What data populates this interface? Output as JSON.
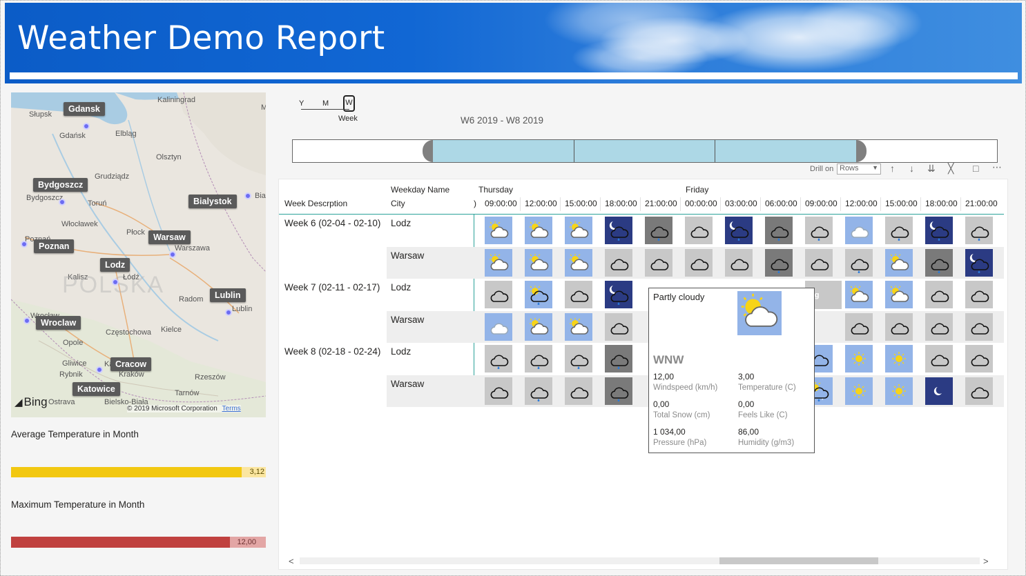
{
  "report": {
    "title": "Weather Demo Report"
  },
  "map": {
    "cities": [
      "Gdansk",
      "Bydgoszcz",
      "Bialystok",
      "Warsaw",
      "Poznan",
      "Lodz",
      "Lublin",
      "Wroclaw",
      "Cracow",
      "Katowice"
    ],
    "places": [
      "Kaliningrad",
      "Słupsk",
      "Gdańsk",
      "Elbląg",
      "Olsztyn",
      "Grudziądz",
      "Bydgoszcz",
      "Toruń",
      "Bia",
      "Włocławek",
      "Płock",
      "Warszawa",
      "Poznań",
      "Kalisz",
      "POLSKA",
      "Łódź",
      "Radom",
      "Lublin",
      "Wrocław",
      "Kielce",
      "Częstochowa",
      "Opole",
      "Gliwice",
      "Katowice",
      "Kraków",
      "Rybnik",
      "Rzeszów",
      "Tarnów",
      "Ostrava",
      "Bielsko-Biała",
      "M"
    ],
    "brand": "Bing",
    "copyright": "© 2019 Microsoft Corporation",
    "terms": "Terms"
  },
  "kpis": [
    {
      "title": "Average Temperature in Month",
      "value": "3,12",
      "fill": 0.905,
      "color": "#f2c811"
    },
    {
      "title": "Maximum Temperature in Month",
      "value": "12,00",
      "fill": 0.86,
      "color": "#c0413f"
    }
  ],
  "slicer": {
    "levels": [
      "Y",
      "M",
      "W"
    ],
    "level_caption": "Week",
    "range": "W6 2019 - W8 2019"
  },
  "toolbar": {
    "drill_label": "Drill on",
    "drill_value": "Rows"
  },
  "matrix": {
    "col_header_1": "Week Descrption",
    "row_header_1": "Weekday Name",
    "row_header_2": "City",
    "days": [
      "Thursday",
      "Friday"
    ],
    "partial_col": ")",
    "times": [
      "09:00:00",
      "12:00:00",
      "15:00:00",
      "18:00:00",
      "21:00:00",
      "00:00:00",
      "03:00:00",
      "06:00:00",
      "09:00:00",
      "12:00:00",
      "15:00:00",
      "18:00:00",
      "21:00:00"
    ],
    "rows": [
      {
        "week": "Week 6 (02-04 - 02-10)",
        "city": "Lodz"
      },
      {
        "week": "",
        "city": "Warsaw"
      },
      {
        "week": "Week 7 (02-11 - 02-17)",
        "city": "Lodz"
      },
      {
        "week": "",
        "city": "Warsaw"
      },
      {
        "week": "Week 8 (02-18 - 02-24)",
        "city": "Lodz"
      },
      {
        "week": "",
        "city": "Warsaw"
      }
    ],
    "partial_label": "og",
    "icons": [
      [
        "pcloudy",
        "pcloudy",
        "pcloudy",
        "night-rain",
        "cloud-rain-dark",
        "cloud",
        "night-rain",
        "cloud-rain-dark",
        "cloud-rain",
        "pcloud-light",
        "cloud-rain",
        "night-rain",
        "cloud-rain"
      ],
      [
        "pcloudy",
        "pcloudy",
        "pcloudy",
        "cloud",
        "cloud",
        "cloud",
        "cloud",
        "cloud-rain-dark",
        "cloud",
        "cloud-rain",
        "pcloudy",
        "cloud-rain-dark",
        "night-rain"
      ],
      [
        "cloud",
        "pcloudy-rain",
        "cloud",
        "night-rain",
        "",
        "",
        "",
        "",
        "pcloudy-gray",
        "pcloudy",
        "pcloudy",
        "cloud",
        "cloud"
      ],
      [
        "pcloud-light",
        "pcloudy",
        "pcloudy",
        "cloud",
        "",
        "",
        "",
        "",
        "fog",
        "cloud",
        "cloud",
        "cloud",
        "cloud"
      ],
      [
        "cloud-rain",
        "cloud-rain",
        "cloud-rain",
        "cloud-rain-dark",
        "",
        "",
        "",
        "",
        "cloud-blue",
        "sunny",
        "sunny",
        "cloud",
        "cloud"
      ],
      [
        "cloud",
        "cloud-rain",
        "cloud",
        "cloud-rain-dark",
        "",
        "",
        "",
        "",
        "pcloudy-snow",
        "sunny",
        "sunny",
        "night-clear",
        "cloud"
      ]
    ]
  },
  "tooltip": {
    "condition": "Partly cloudy",
    "wind_dir": "WNW",
    "items": [
      {
        "value": "12,00",
        "label": "Windspeed (km/h)"
      },
      {
        "value": "3,00",
        "label": "Temperature (C)"
      },
      {
        "value": "0,00",
        "label": "Total Snow (cm)"
      },
      {
        "value": "0,00",
        "label": "Feels Like (C)"
      },
      {
        "value": "1 034,00",
        "label": "Pressure (hPa)"
      },
      {
        "value": "86,00",
        "label": "Humidity (g/m3)"
      }
    ]
  },
  "scroll": {
    "left": "<",
    "right": ">"
  },
  "colors": {
    "header_blue": "#0b5cc7",
    "tile_blue": "#93b4e8",
    "tile_gray": "#c8c8c8",
    "tile_dark": "#7a7a7a",
    "tile_navy": "#2b3b83",
    "teal_line": "#2aa198"
  }
}
